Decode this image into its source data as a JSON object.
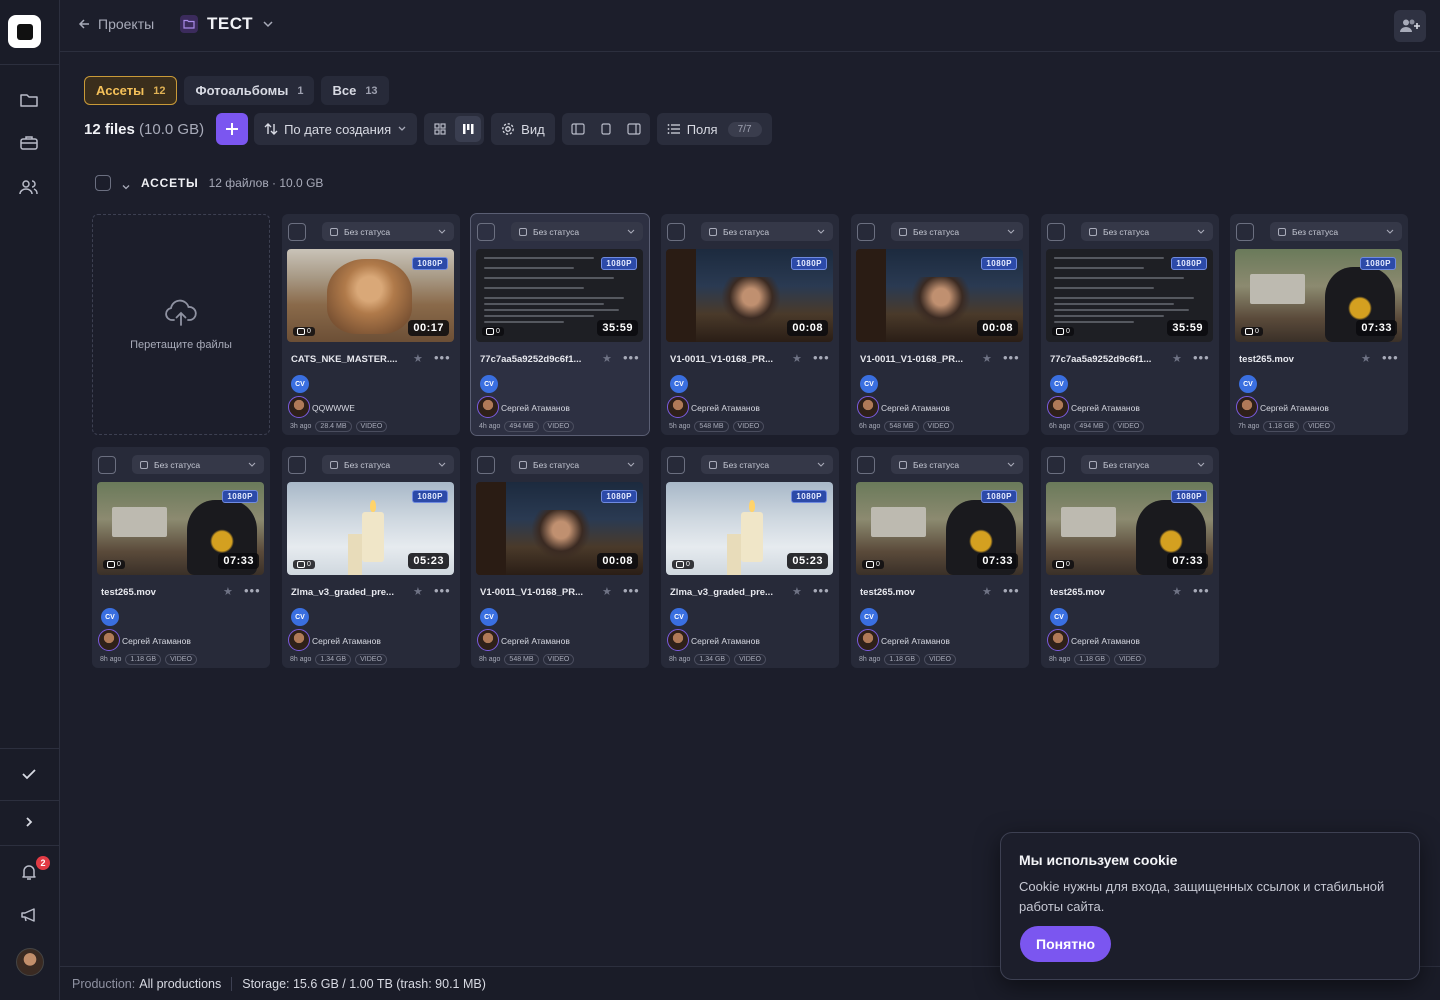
{
  "nav": {
    "back_label": "Проекты",
    "project_name": "ТЕСТ",
    "notifications_count": "2"
  },
  "tabs": [
    {
      "label": "Ассеты",
      "count": "12"
    },
    {
      "label": "Фотоальбомы",
      "count": "1"
    },
    {
      "label": "Все",
      "count": "13"
    }
  ],
  "toolbar": {
    "files_count": "12 files",
    "files_size": "(10.0 GB)",
    "sort_label": "По дате создания",
    "view_label": "Вид",
    "fields_label": "Поля",
    "fields_count": "7/7"
  },
  "group": {
    "title": "АССЕТЫ",
    "meta": "12 файлов · 10.0 GB"
  },
  "upload": {
    "label": "Перетащите файлы"
  },
  "status_default": "Без статуса",
  "cards": [
    {
      "name": "CATS_NKE_MASTER....",
      "resolution": "1080P",
      "duration": "00:17",
      "comments": "0",
      "avatar": "CV",
      "user": "QQWWWE",
      "age": "3h ago",
      "size": "28.4 MB",
      "kind": "VIDEO",
      "thumb": "cat"
    },
    {
      "name": "77c7aa5a9252d9c6f1...",
      "resolution": "1080P",
      "duration": "35:59",
      "comments": "0",
      "avatar": "CV",
      "user": "Сергей Атаманов",
      "age": "4h ago",
      "size": "494 MB",
      "kind": "VIDEO",
      "thumb": "doc"
    },
    {
      "name": "V1-0011_V1-0168_PR...",
      "resolution": "1080P",
      "duration": "00:08",
      "comments": "0",
      "avatar": "CV",
      "user": "Сергей Атаманов",
      "age": "5h ago",
      "size": "548 MB",
      "kind": "VIDEO",
      "thumb": "porch"
    },
    {
      "name": "V1-0011_V1-0168_PR...",
      "resolution": "1080P",
      "duration": "00:08",
      "comments": "0",
      "avatar": "CV",
      "user": "Сергей Атаманов",
      "age": "6h ago",
      "size": "548 MB",
      "kind": "VIDEO",
      "thumb": "porch"
    },
    {
      "name": "77c7aa5a9252d9c6f1...",
      "resolution": "1080P",
      "duration": "35:59",
      "comments": "0",
      "avatar": "CV",
      "user": "Сергей Атаманов",
      "age": "6h ago",
      "size": "494 MB",
      "kind": "VIDEO",
      "thumb": "doc"
    },
    {
      "name": "test265.mov",
      "resolution": "1080P",
      "duration": "07:33",
      "comments": "0",
      "avatar": "CV",
      "user": "Сергей Атаманов",
      "age": "7h ago",
      "size": "1.18 GB",
      "kind": "VIDEO",
      "thumb": "cadet"
    },
    {
      "name": "test265.mov",
      "resolution": "1080P",
      "duration": "07:33",
      "comments": "0",
      "avatar": "CV",
      "user": "Сергей Атаманов",
      "age": "8h ago",
      "size": "1.18 GB",
      "kind": "VIDEO",
      "thumb": "cadet"
    },
    {
      "name": "Zlma_v3_graded_pre...",
      "resolution": "1080P",
      "duration": "05:23",
      "comments": "0",
      "avatar": "CV",
      "user": "Сергей Атаманов",
      "age": "8h ago",
      "size": "1.34 GB",
      "kind": "VIDEO",
      "thumb": "candle"
    },
    {
      "name": "V1-0011_V1-0168_PR...",
      "resolution": "1080P",
      "duration": "00:08",
      "comments": "1",
      "avatar": "CV",
      "user": "Сергей Атаманов",
      "age": "8h ago",
      "size": "548 MB",
      "kind": "VIDEO",
      "thumb": "porch"
    },
    {
      "name": "Zlma_v3_graded_pre...",
      "resolution": "1080P",
      "duration": "05:23",
      "comments": "0",
      "avatar": "CV",
      "user": "Сергей Атаманов",
      "age": "8h ago",
      "size": "1.34 GB",
      "kind": "VIDEO",
      "thumb": "candle"
    },
    {
      "name": "test265.mov",
      "resolution": "1080P",
      "duration": "07:33",
      "comments": "0",
      "avatar": "CV",
      "user": "Сергей Атаманов",
      "age": "8h ago",
      "size": "1.18 GB",
      "kind": "VIDEO",
      "thumb": "cadet"
    },
    {
      "name": "test265.mov",
      "resolution": "1080P",
      "duration": "07:33",
      "comments": "0",
      "avatar": "CV",
      "user": "Сергей Атаманов",
      "age": "8h ago",
      "size": "1.18 GB",
      "kind": "VIDEO",
      "thumb": "cadet"
    }
  ],
  "footer": {
    "production_key": "Production:",
    "production_value": "All productions",
    "storage": "Storage: 15.6 GB / 1.00 TB (trash: 90.1 MB)"
  },
  "cookie": {
    "title": "Мы используем cookie",
    "text": "Cookie нужны для входа, защищенных ссылок и стабильной работы сайта.",
    "button": "Понятно"
  },
  "colors": {
    "accent": "#7b56f0",
    "active_tab": "#c99a38",
    "badge": "#e23b45"
  }
}
